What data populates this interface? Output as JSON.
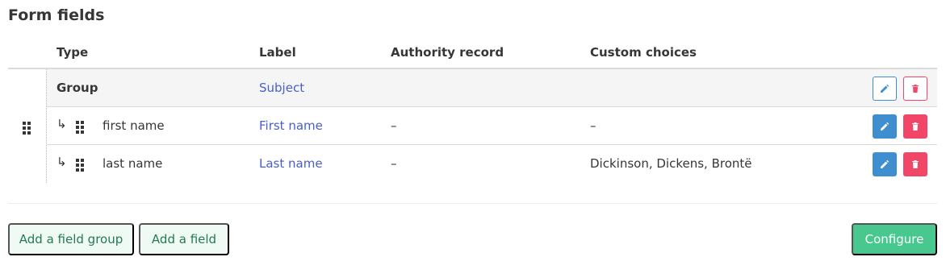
{
  "section_title": "Form fields",
  "columns": {
    "type": "Type",
    "label": "Label",
    "authority": "Authority record",
    "choices": "Custom choices"
  },
  "rows": [
    {
      "type": "Group",
      "label": "Subject",
      "authority": "",
      "choices": ""
    },
    {
      "type": "first name",
      "label": "First name",
      "authority": "–",
      "choices": "–"
    },
    {
      "type": "last name",
      "label": "Last name",
      "authority": "–",
      "choices": "Dickinson, Dickens, Brontë"
    }
  ],
  "child_arrow": "↳",
  "buttons": {
    "add_group": "Add a field group",
    "add_field": "Add a field",
    "configure": "Configure"
  },
  "colors": {
    "link": "#485fc7",
    "info": "#3e8ed0",
    "danger": "#f14668",
    "success": "#48c78e",
    "success_light": "#effaf5",
    "success_dark": "#257953"
  },
  "icons": {
    "drag": "drag-handle-icon",
    "edit": "pencil-icon",
    "delete": "trash-icon"
  }
}
